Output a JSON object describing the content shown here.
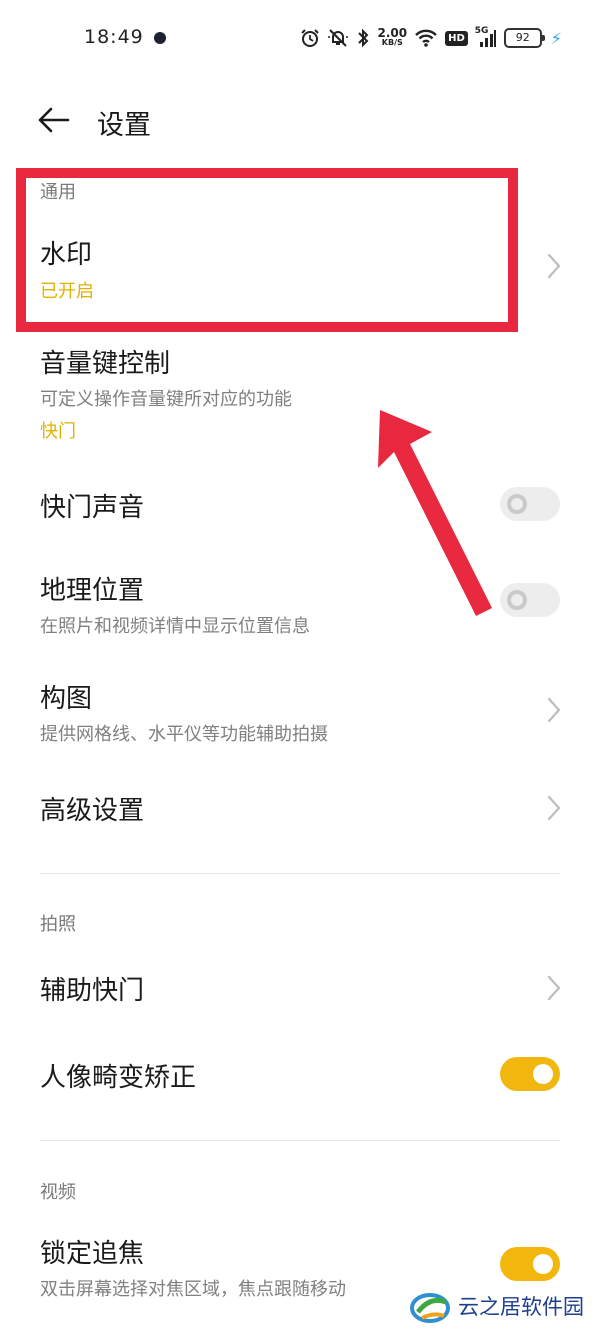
{
  "status_bar": {
    "time": "18:49",
    "net_speed_value": "2.00",
    "net_speed_unit": "KB/S",
    "hd_label": "HD",
    "signal_label": "5G",
    "battery": "92"
  },
  "header": {
    "title": "设置"
  },
  "sections": {
    "general": "通用",
    "photo": "拍照",
    "video": "视频"
  },
  "rows": {
    "watermark": {
      "title": "水印",
      "value": "已开启"
    },
    "volume_key": {
      "title": "音量键控制",
      "subtitle": "可定义操作音量键所对应的功能",
      "value": "快门"
    },
    "shutter_sound": {
      "title": "快门声音",
      "enabled": false
    },
    "location": {
      "title": "地理位置",
      "subtitle": "在照片和视频详情中显示位置信息",
      "enabled": false
    },
    "composition": {
      "title": "构图",
      "subtitle": "提供网格线、水平仪等功能辅助拍摄"
    },
    "advanced": {
      "title": "高级设置"
    },
    "assist_shutter": {
      "title": "辅助快门"
    },
    "portrait_distortion": {
      "title": "人像畸变矫正",
      "enabled": true
    },
    "focus_lock": {
      "title": "锁定追焦",
      "subtitle": "双击屏幕选择对焦区域，焦点跟随移动",
      "enabled": true
    }
  },
  "watermark_logo": {
    "text": "云之居软件园"
  },
  "colors": {
    "accent": "#f2b70f",
    "value_text": "#e0b200",
    "annotation_red": "#e8283f",
    "charging": "#23a9f2"
  }
}
